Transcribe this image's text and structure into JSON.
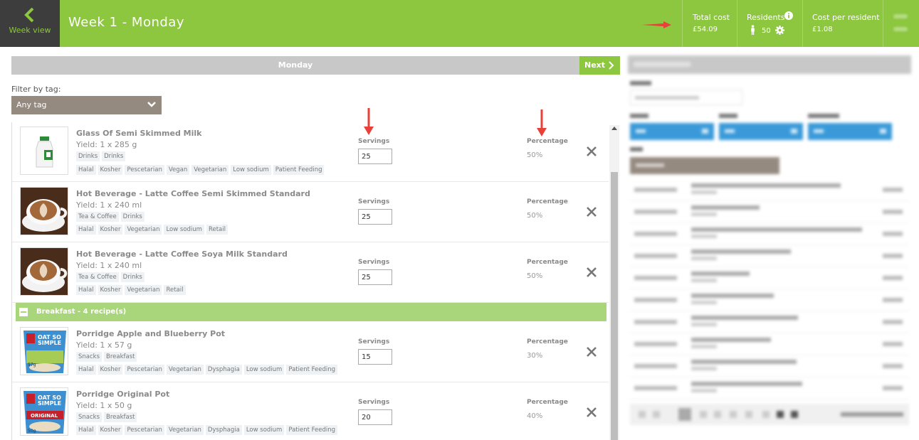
{
  "header": {
    "back_label": "Week view",
    "title": "Week 1 - Monday",
    "stats": {
      "total_cost_label": "Total cost",
      "total_cost_value": "£54.09",
      "residents_label": "Residents",
      "residents_value": "50",
      "cost_per_resident_label": "Cost per resident",
      "cost_per_resident_value": "£1.08"
    }
  },
  "day_nav": {
    "day_label": "Monday",
    "next_label": "Next"
  },
  "filter": {
    "label": "Filter by tag:",
    "selected": "Any tag"
  },
  "column_labels": {
    "servings": "Servings",
    "percentage": "Percentage"
  },
  "recipes_top": [
    {
      "name": "Glass Of Semi Skimmed Milk",
      "yield": "Yield: 1 x 285 g",
      "categories": [
        "Drinks",
        "Drinks"
      ],
      "tags": [
        "Halal",
        "Kosher",
        "Pescetarian",
        "Vegan",
        "Vegetarian",
        "Low sodium",
        "Patient Feeding"
      ],
      "servings": "25",
      "percentage": "50%",
      "image": "milk-bottle"
    },
    {
      "name": "Hot Beverage - Latte Coffee Semi Skimmed Standard",
      "yield": "Yield: 1 x 240 ml",
      "categories": [
        "Tea & Coffee",
        "Drinks"
      ],
      "tags": [
        "Halal",
        "Kosher",
        "Vegetarian",
        "Low sodium",
        "Retail"
      ],
      "servings": "25",
      "percentage": "50%",
      "image": "latte-cup"
    },
    {
      "name": "Hot Beverage - Latte Coffee Soya Milk Standard",
      "yield": "Yield: 1 x 240 ml",
      "categories": [
        "Tea & Coffee",
        "Drinks"
      ],
      "tags": [
        "Halal",
        "Kosher",
        "Vegetarian",
        "Retail"
      ],
      "servings": "25",
      "percentage": "50%",
      "image": "latte-cup"
    }
  ],
  "group": {
    "title": "Breakfast - 4 recipe(s)"
  },
  "recipes_breakfast": [
    {
      "name": "Porridge Apple and Blueberry Pot",
      "yield": "Yield: 1 x 57 g",
      "categories": [
        "Snacks",
        "Breakfast"
      ],
      "tags": [
        "Halal",
        "Kosher",
        "Pescetarian",
        "Vegetarian",
        "Dysphagia",
        "Low sodium",
        "Patient Feeding"
      ],
      "servings": "15",
      "percentage": "30%",
      "image": "oat-pot-apple"
    },
    {
      "name": "Porridge Original Pot",
      "yield": "Yield: 1 x 50 g",
      "categories": [
        "Snacks",
        "Breakfast"
      ],
      "tags": [
        "Halal",
        "Kosher",
        "Pescetarian",
        "Vegetarian",
        "Dysphagia",
        "Low sodium",
        "Patient Feeding"
      ],
      "servings": "20",
      "percentage": "40%",
      "image": "oat-pot-original"
    }
  ],
  "colors": {
    "brand_green": "#8dc63f",
    "dark": "#3d3d3d",
    "group_green": "#a9d67a",
    "annotation_red": "#e8413a"
  }
}
